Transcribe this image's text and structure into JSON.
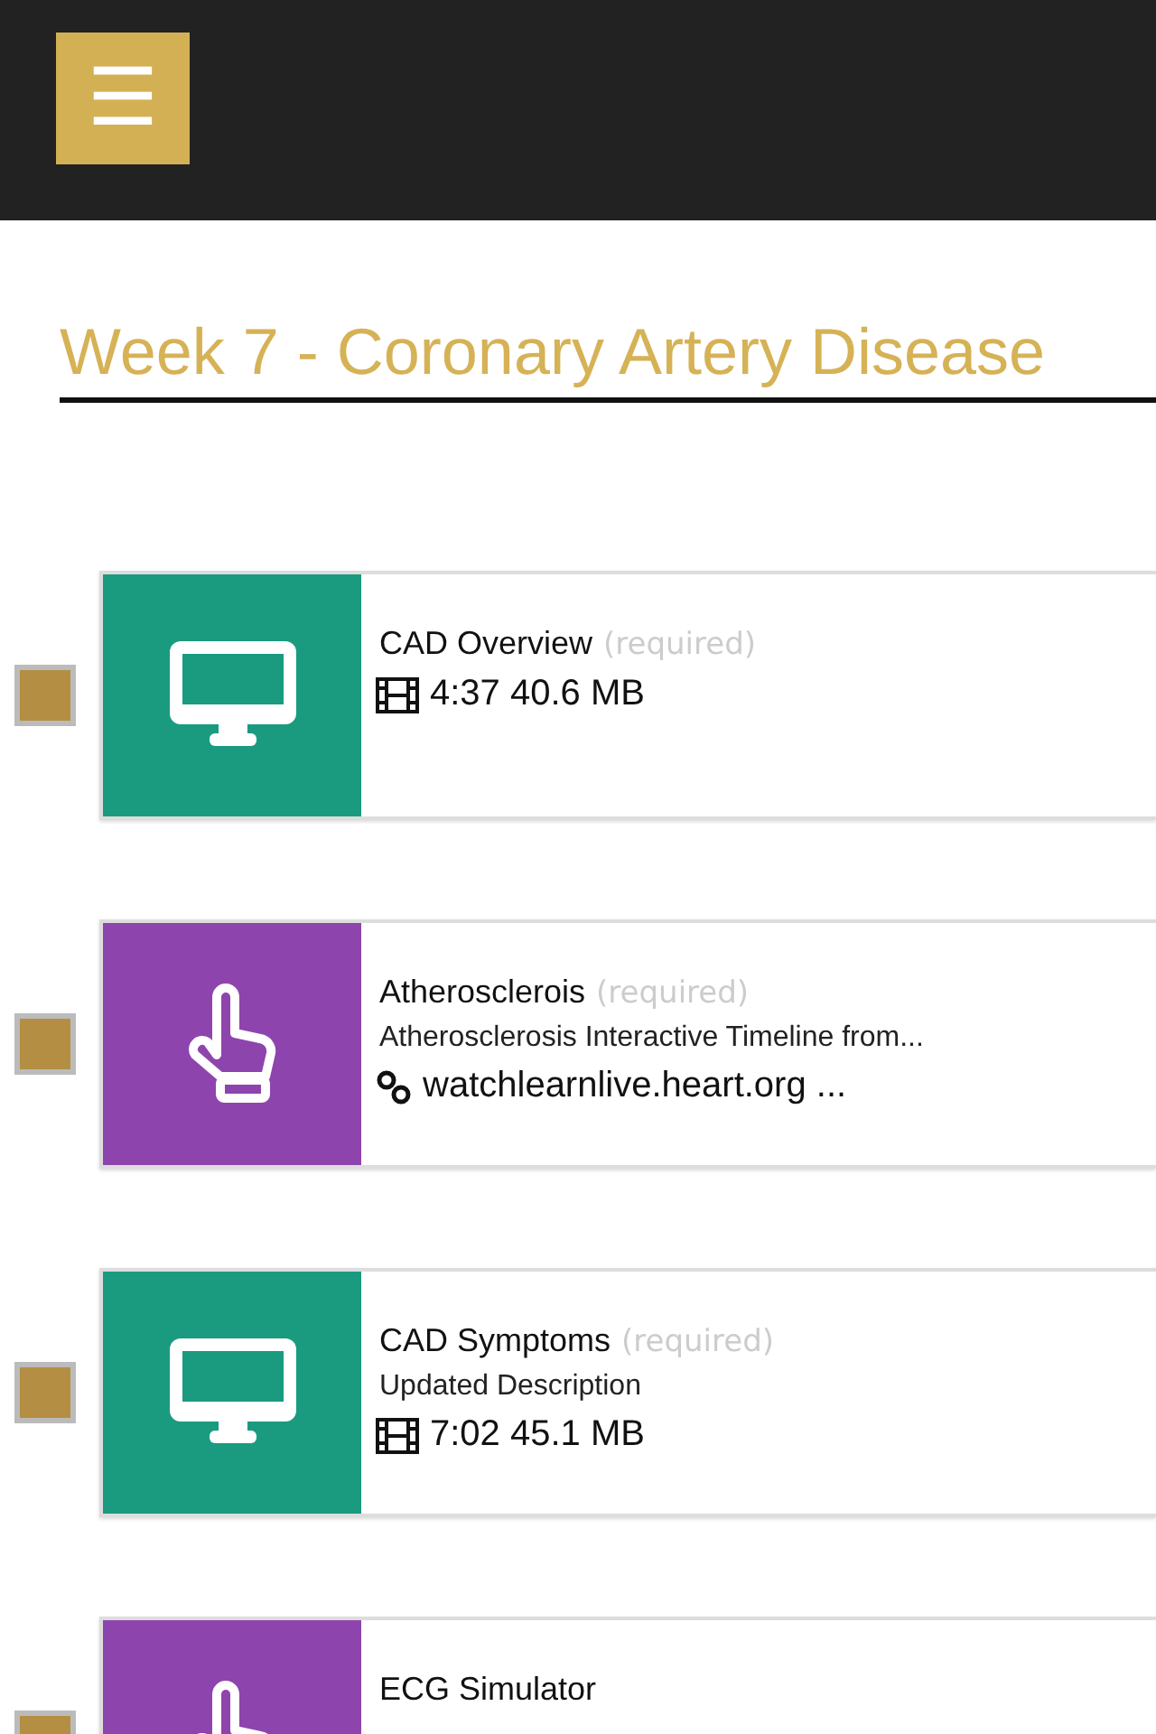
{
  "header": {
    "menu_button": "☰"
  },
  "title": "Week 7 - Coronary Artery Disease",
  "items": [
    {
      "kind": "video",
      "checked": false,
      "title": "CAD Overview",
      "tag": "(required)",
      "meta": {
        "kind": "video",
        "text": "4:37 40.6 MB"
      }
    },
    {
      "kind": "interactive",
      "checked": false,
      "title": "Atherosclerois",
      "tag": "(required)",
      "description": "Atherosclerosis Interactive Timeline from...",
      "meta": {
        "kind": "link",
        "text": "watchlearnlive.heart.org ..."
      }
    },
    {
      "kind": "video",
      "checked": false,
      "title": "CAD Symptoms",
      "tag": "(required)",
      "description": "Updated Description",
      "meta": {
        "kind": "video",
        "text": "7:02 45.1 MB"
      }
    },
    {
      "kind": "interactive",
      "checked": false,
      "title": "ECG Simulator"
    }
  ]
}
